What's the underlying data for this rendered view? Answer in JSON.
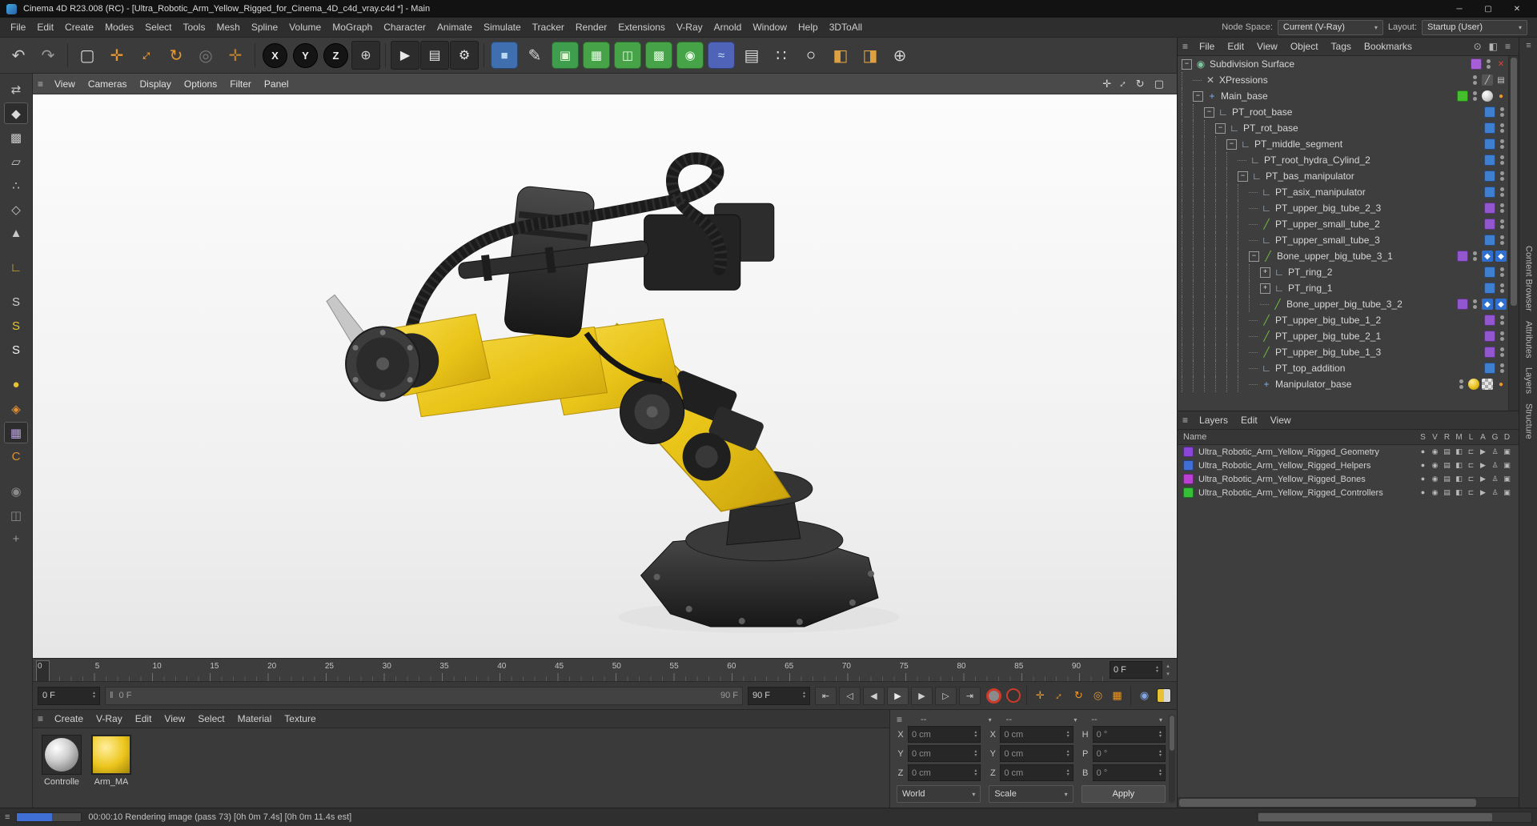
{
  "window": {
    "title": "Cinema 4D R23.008 (RC) - [Ultra_Robotic_Arm_Yellow_Rigged_for_Cinema_4D_c4d_vray.c4d *] - Main",
    "minimize_glyph": "─",
    "maximize_glyph": "▢",
    "close_glyph": "✕"
  },
  "icons": {
    "burger": "≡",
    "caret": "▾",
    "spin_up": "▴",
    "spin_down": "▾",
    "nav_up": "▴",
    "nav_down": "▾"
  },
  "menu_bar": {
    "items": [
      "File",
      "Edit",
      "Create",
      "Modes",
      "Select",
      "Tools",
      "Mesh",
      "Spline",
      "Volume",
      "MoGraph",
      "Character",
      "Animate",
      "Simulate",
      "Tracker",
      "Render",
      "Extensions",
      "V-Ray",
      "Arnold",
      "Window",
      "Help",
      "3DToAll"
    ],
    "node_space_label": "Node Space:",
    "node_space_value": "Current (V-Ray)",
    "layout_label": "Layout:",
    "layout_value": "Startup (User)"
  },
  "toolbar": {
    "items": [
      {
        "name": "undo-icon",
        "glyph": "↶",
        "color": "#cccccc"
      },
      {
        "name": "redo-icon",
        "glyph": "↷",
        "color": "#9b9b9b"
      },
      {
        "kind": "sep"
      },
      {
        "name": "live-selection-icon",
        "glyph": "▢",
        "color": "#d8d8d8"
      },
      {
        "name": "move-tool-icon",
        "glyph": "✛",
        "color": "#e6982f"
      },
      {
        "name": "scale-tool-icon",
        "glyph": "↕",
        "color": "#e6982f",
        "rotate": true
      },
      {
        "name": "rotate-tool-icon",
        "glyph": "↻",
        "color": "#e6982f"
      },
      {
        "name": "recent-tool-icon",
        "glyph": "◎",
        "color": "#777777"
      },
      {
        "name": "axis-modify-icon",
        "glyph": "✛",
        "color": "#b97f2e"
      },
      {
        "kind": "sep"
      },
      {
        "name": "x-axis-lock-button",
        "kind": "circle",
        "label": "X"
      },
      {
        "name": "y-axis-lock-button",
        "kind": "circle",
        "label": "Y"
      },
      {
        "name": "z-axis-lock-button",
        "kind": "circle",
        "label": "Z"
      },
      {
        "name": "coordinate-system-icon",
        "glyph": "⊕",
        "color": "#d0d0d0",
        "dark": true
      },
      {
        "kind": "sep"
      },
      {
        "name": "render-view-icon",
        "glyph": "▶",
        "color": "#e8e8e8",
        "dark": true
      },
      {
        "name": "render-picture-viewer-icon",
        "glyph": "▤",
        "color": "#e8e8e8",
        "dark": true
      },
      {
        "name": "render-settings-icon",
        "glyph": "⚙",
        "color": "#e8e8e8",
        "dark": true
      },
      {
        "kind": "sep"
      },
      {
        "name": "cube-primitive-icon",
        "glyph": "■",
        "color": "#bcd9f2",
        "tile": "#3f6fae"
      },
      {
        "name": "pen-spline-icon",
        "glyph": "✎",
        "color": "#d8d8d8"
      },
      {
        "name": "subdivision-surface-icon",
        "glyph": "▣",
        "color": "#e2f6d2",
        "tile": "#3f9e4e"
      },
      {
        "name": "cloner-icon",
        "glyph": "▦",
        "color": "#e6ffe6",
        "tile": "#47a347"
      },
      {
        "name": "fracture-icon",
        "glyph": "◫",
        "color": "#e6ffe6",
        "tile": "#47a347"
      },
      {
        "name": "matrix-icon",
        "glyph": "▩",
        "color": "#e6ffe6",
        "tile": "#47a347"
      },
      {
        "name": "field-icon",
        "glyph": "◉",
        "color": "#e6ffe6",
        "tile": "#47a347"
      },
      {
        "name": "deformer-icon",
        "glyph": "≈",
        "color": "#cfe0ff",
        "tile": "#4f63b8"
      },
      {
        "name": "grid-array-icon",
        "glyph": "▤",
        "color": "#d8d8d8"
      },
      {
        "name": "dots-icon",
        "glyph": "∷",
        "color": "#d8d8d8"
      },
      {
        "name": "light-icon",
        "glyph": "○",
        "color": "#f2f2f2"
      },
      {
        "name": "xpresso-editor-icon",
        "glyph": "◧",
        "color": "#e0a040"
      },
      {
        "name": "material-nodes-icon",
        "glyph": "◨",
        "color": "#e0a040"
      },
      {
        "name": "earth-icon",
        "glyph": "⊕",
        "color": "#cfcfcf"
      }
    ]
  },
  "tool_strip": {
    "items": [
      {
        "name": "make-editable-icon",
        "glyph": "⇄",
        "color": "#c9c9c9"
      },
      {
        "name": "model-mode-icon",
        "glyph": "◆",
        "color": "#d9d9d9",
        "active": true
      },
      {
        "name": "texture-mode-icon",
        "glyph": "▩",
        "color": "#c9c9c9"
      },
      {
        "name": "workplane-mode-icon",
        "glyph": "▱",
        "color": "#c9c9c9"
      },
      {
        "name": "points-mode-icon",
        "glyph": "∴",
        "color": "#c9c9c9"
      },
      {
        "name": "edges-mode-icon",
        "glyph": "◇",
        "color": "#c9c9c9"
      },
      {
        "name": "polygons-mode-icon",
        "glyph": "▲",
        "color": "#c9c9c9"
      },
      {
        "kind": "gap"
      },
      {
        "name": "enable-axis-icon",
        "glyph": "∟",
        "color": "#e0b93c"
      },
      {
        "kind": "gap"
      },
      {
        "name": "solo-off-icon",
        "glyph": "S",
        "color": "#cfcfcf"
      },
      {
        "name": "solo-single-icon",
        "glyph": "S",
        "color": "#e8c235"
      },
      {
        "name": "solo-hierarchy-icon",
        "glyph": "S",
        "color": "#f2f2f2"
      },
      {
        "kind": "gap"
      },
      {
        "name": "paint-tool-icon",
        "glyph": "●",
        "color": "#e8c235"
      },
      {
        "name": "snap-icon",
        "glyph": "◈",
        "color": "#e09030"
      },
      {
        "name": "quantize-icon",
        "glyph": "▦",
        "color": "#b9a0e0",
        "active": true
      },
      {
        "name": "modeling-axis-icon",
        "glyph": "C",
        "color": "#e09030"
      },
      {
        "kind": "gap"
      },
      {
        "name": "magnet-tool-icon",
        "glyph": "◉",
        "color": "#8a8a8a"
      },
      {
        "name": "mirror-tool-icon",
        "glyph": "◫",
        "color": "#8a8a8a"
      },
      {
        "name": "add-tool-icon",
        "glyph": "+",
        "color": "#9a9a9a"
      }
    ]
  },
  "viewport": {
    "menus": [
      "View",
      "Cameras",
      "Display",
      "Options",
      "Filter",
      "Panel"
    ],
    "corner_icons": [
      {
        "name": "pan-view-icon",
        "glyph": "✛"
      },
      {
        "name": "zoom-view-icon",
        "glyph": "↕",
        "rotate": true
      },
      {
        "name": "rotate-view-icon",
        "glyph": "↻"
      },
      {
        "name": "toggle-panels-icon",
        "glyph": "▢"
      }
    ]
  },
  "timeline": {
    "ticks": [
      "0",
      "5",
      "10",
      "15",
      "20",
      "25",
      "30",
      "35",
      "40",
      "45",
      "50",
      "55",
      "60",
      "65",
      "70",
      "75",
      "80",
      "85",
      "90"
    ],
    "current_frame": "0 F",
    "range_start": "0 F",
    "playhead_label": "0 F",
    "range_end_label": "90 F",
    "range_end": "90 F",
    "handle_glyph": "‖",
    "transport": [
      {
        "name": "goto-start-button",
        "glyph": "⇤"
      },
      {
        "name": "prev-key-button",
        "glyph": "◁"
      },
      {
        "name": "prev-frame-button",
        "glyph": "◀"
      },
      {
        "name": "play-button",
        "glyph": "▶",
        "active": true
      },
      {
        "name": "next-frame-button",
        "glyph": "▶"
      },
      {
        "name": "next-key-button",
        "glyph": "▷"
      },
      {
        "name": "goto-end-button",
        "glyph": "⇥"
      }
    ],
    "key_buttons": [
      {
        "name": "record-keyframe-button",
        "kind": "record"
      },
      {
        "name": "autokey-button",
        "kind": "autokey"
      },
      {
        "kind": "sep"
      },
      {
        "name": "keyframe-position-toggle",
        "glyph": "✛",
        "color": "#e6982f"
      },
      {
        "name": "keyframe-scale-toggle",
        "glyph": "↕",
        "color": "#e6982f",
        "rotate": true
      },
      {
        "name": "keyframe-rotation-toggle",
        "glyph": "↻",
        "color": "#e6982f"
      },
      {
        "name": "keyframe-parameter-toggle",
        "glyph": "◎",
        "color": "#e6982f"
      },
      {
        "name": "keyframe-pla-toggle",
        "glyph": "▦",
        "color": "#e6982f"
      },
      {
        "kind": "sep"
      },
      {
        "name": "magnet-snap-icon",
        "glyph": "◉",
        "color": "#7fa8e8"
      },
      {
        "name": "workplane-toggle-icon",
        "kind": "split"
      }
    ]
  },
  "materials_panel": {
    "menus": [
      "Create",
      "V-Ray",
      "Edit",
      "View",
      "Select",
      "Material",
      "Texture"
    ],
    "materials": [
      {
        "name": "Controlle",
        "kind": "gray"
      },
      {
        "name": "Arm_MA",
        "kind": "yellow"
      }
    ]
  },
  "coordinates_panel": {
    "header": [
      "--",
      "--",
      "--"
    ],
    "position": {
      "labels": [
        "X",
        "Y",
        "Z"
      ],
      "values": [
        "0 cm",
        "0 cm",
        "0 cm"
      ]
    },
    "scale": {
      "labels": [
        "X",
        "Y",
        "Z"
      ],
      "values": [
        "0 cm",
        "0 cm",
        "0 cm"
      ]
    },
    "rotation": {
      "labels": [
        "H",
        "P",
        "B"
      ],
      "values": [
        "0 °",
        "0 °",
        "0 °"
      ]
    },
    "dropdown1": "World",
    "dropdown2": "Scale",
    "apply": "Apply"
  },
  "object_manager": {
    "menus": [
      "File",
      "Edit",
      "View",
      "Object",
      "Tags",
      "Bookmarks"
    ],
    "corner_icons": [
      {
        "name": "search-icon",
        "glyph": "⊙"
      },
      {
        "name": "filter-icon",
        "glyph": "◧"
      },
      {
        "name": "panel-menu-icon",
        "glyph": "≡"
      }
    ],
    "tree": [
      {
        "name": "Subdivision Surface",
        "depth": 0,
        "exp": "minus",
        "icon": "sds",
        "chip": "#a65fd6",
        "tags": [
          "red-x"
        ]
      },
      {
        "name": "XPressions",
        "depth": 1,
        "exp": null,
        "icon": "xpresso",
        "chip": null,
        "tags": [
          "slash",
          "film"
        ]
      },
      {
        "name": "Main_base",
        "depth": 1,
        "exp": "minus",
        "icon": "axis",
        "chip": "#43bf2e",
        "tags": [
          "sphere",
          "orange-dot"
        ]
      },
      {
        "name": "PT_root_base",
        "depth": 2,
        "exp": "minus",
        "icon": "null",
        "chip": "#3f7fd0",
        "tags": []
      },
      {
        "name": "PT_rot_base",
        "depth": 3,
        "exp": "minus",
        "icon": "null",
        "chip": "#3f7fd0",
        "tags": []
      },
      {
        "name": "PT_middle_segment",
        "depth": 4,
        "exp": "minus",
        "icon": "null",
        "chip": "#3f7fd0",
        "tags": []
      },
      {
        "name": "PT_root_hydra_Cylind_2",
        "depth": 5,
        "exp": null,
        "icon": "null",
        "chip": "#3f7fd0",
        "tags": []
      },
      {
        "name": "PT_bas_manipulator",
        "depth": 5,
        "exp": "minus",
        "icon": "null",
        "chip": "#3f7fd0",
        "tags": []
      },
      {
        "name": "PT_asix_manipulator",
        "depth": 6,
        "exp": null,
        "icon": "null",
        "chip": "#3f7fd0",
        "tags": []
      },
      {
        "name": "PT_upper_big_tube_2_3",
        "depth": 6,
        "exp": null,
        "icon": "null",
        "chip": "#9257cf",
        "tags": []
      },
      {
        "name": "PT_upper_small_tube_2",
        "depth": 6,
        "exp": null,
        "icon": "spline",
        "chip": "#9257cf",
        "tags": []
      },
      {
        "name": "PT_upper_small_tube_3",
        "depth": 6,
        "exp": null,
        "icon": "null",
        "chip": "#3f7fd0",
        "tags": []
      },
      {
        "name": "Bone_upper_big_tube_3_1",
        "depth": 6,
        "exp": "minus",
        "icon": "spline",
        "chip": "#9257cf",
        "tags": [
          "ik",
          "ik"
        ]
      },
      {
        "name": "PT_ring_2",
        "depth": 7,
        "exp": "plus",
        "icon": "null",
        "chip": "#3f7fd0",
        "tags": []
      },
      {
        "name": "PT_ring_1",
        "depth": 7,
        "exp": "plus",
        "icon": "null",
        "chip": "#3f7fd0",
        "tags": []
      },
      {
        "name": "Bone_upper_big_tube_3_2",
        "depth": 7,
        "exp": null,
        "icon": "spline",
        "chip": "#9257cf",
        "tags": [
          "ik",
          "ik"
        ]
      },
      {
        "name": "PT_upper_big_tube_1_2",
        "depth": 6,
        "exp": null,
        "icon": "spline",
        "chip": "#9257cf",
        "tags": []
      },
      {
        "name": "PT_upper_big_tube_2_1",
        "depth": 6,
        "exp": null,
        "icon": "spline",
        "chip": "#9257cf",
        "tags": []
      },
      {
        "name": "PT_upper_big_tube_1_3",
        "depth": 6,
        "exp": null,
        "icon": "spline",
        "chip": "#9257cf",
        "tags": []
      },
      {
        "name": "PT_top_addition",
        "depth": 6,
        "exp": null,
        "icon": "null",
        "chip": "#3f7fd0",
        "tags": []
      },
      {
        "name": "Manipulator_base",
        "depth": 6,
        "exp": null,
        "icon": "axis",
        "chip": null,
        "tags": [
          "mat-yellow",
          "checker",
          "orange-dot"
        ]
      }
    ]
  },
  "layers_panel": {
    "menus": [
      "Layers",
      "Edit",
      "View"
    ],
    "name_header": "Name",
    "columns": [
      "S",
      "V",
      "R",
      "M",
      "L",
      "A",
      "G",
      "D"
    ],
    "row_icons": [
      {
        "name": "solo-dot-icon",
        "glyph": "●"
      },
      {
        "name": "view-icon",
        "glyph": "◉"
      },
      {
        "name": "render-icon",
        "glyph": "▤"
      },
      {
        "name": "manager-icon",
        "glyph": "◧"
      },
      {
        "name": "lock-icon",
        "glyph": "⊏"
      },
      {
        "name": "animation-icon",
        "glyph": "▶"
      },
      {
        "name": "generators-icon",
        "glyph": "♙"
      },
      {
        "name": "expressions-icon",
        "glyph": "▣"
      }
    ],
    "rows": [
      {
        "name": "Ultra_Robotic_Arm_Yellow_Rigged_Geometry",
        "color": "#8a46d8"
      },
      {
        "name": "Ultra_Robotic_Arm_Yellow_Rigged_Helpers",
        "color": "#3f6fd4"
      },
      {
        "name": "Ultra_Robotic_Arm_Yellow_Rigged_Bones",
        "color": "#bb3fd4"
      },
      {
        "name": "Ultra_Robotic_Arm_Yellow_Rigged_Controllers",
        "color": "#35c135"
      }
    ]
  },
  "dock_tabs": [
    "Content Browser",
    "Attributes",
    "Layers",
    "Structure"
  ],
  "status_bar": {
    "text": "00:00:10 Rendering image (pass 73) [0h 0m 7.4s] [0h 0m 11.4s est]",
    "progress": 55
  }
}
